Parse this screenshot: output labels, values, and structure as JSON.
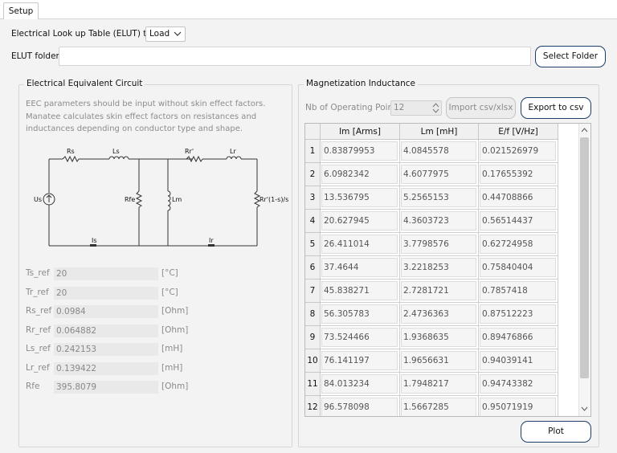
{
  "tabs": [
    {
      "label": "Setup"
    }
  ],
  "elut": {
    "type_label": "Electrical Look up Table (ELUT) type",
    "type_value": "Load",
    "folder_label": "ELUT folder",
    "folder_value": "",
    "select_folder_button": "Select Folder"
  },
  "eec": {
    "title": "Electrical Equivalent Circuit",
    "description": "EEC parameters should be input without skin effect factors. Manatee calculates skin effect factors on resistances and inductances depending on conductor type and shape.",
    "circuit_labels": {
      "rs": "Rs",
      "ls": "Ls",
      "rr": "Rr'",
      "lr": "Lr",
      "us": "Us",
      "rfe": "Rfe",
      "lm": "Lm",
      "rload": "Rr'(1-s)/s",
      "is": "Is",
      "ir": "Ir"
    },
    "params": [
      {
        "label": "Ts_ref",
        "value": "20",
        "unit": "[°C]"
      },
      {
        "label": "Tr_ref",
        "value": "20",
        "unit": "[°C]"
      },
      {
        "label": "Rs_ref",
        "value": "0.0984",
        "unit": "[Ohm]"
      },
      {
        "label": "Rr_ref",
        "value": "0.064882",
        "unit": "[Ohm]"
      },
      {
        "label": "Ls_ref",
        "value": "0.242153",
        "unit": "[mH]"
      },
      {
        "label": "Lr_ref",
        "value": "0.139422",
        "unit": "[mH]"
      },
      {
        "label": "Rfe",
        "value": "395.8079",
        "unit": "[Ohm]"
      }
    ]
  },
  "mag": {
    "title": "Magnetization Inductance",
    "nb_points_label": "Nb of Operating Points",
    "nb_points_value": "12",
    "import_button": "Import csv/xlsx",
    "export_button": "Export to csv",
    "plot_button": "Plot",
    "columns": [
      "Im [Arms]",
      "Lm [mH]",
      "E/f [V/Hz]"
    ],
    "rows": [
      {
        "n": "1",
        "im": "0.83879953",
        "lm": "4.0845578",
        "ef": "0.021526979"
      },
      {
        "n": "2",
        "im": "6.0982342",
        "lm": "4.6077975",
        "ef": "0.17655392"
      },
      {
        "n": "3",
        "im": "13.536795",
        "lm": "5.2565153",
        "ef": "0.44708866"
      },
      {
        "n": "4",
        "im": "20.627945",
        "lm": "4.3603723",
        "ef": "0.56514437"
      },
      {
        "n": "5",
        "im": "26.411014",
        "lm": "3.7798576",
        "ef": "0.62724958"
      },
      {
        "n": "6",
        "im": "37.4644",
        "lm": "3.2218253",
        "ef": "0.75840404"
      },
      {
        "n": "7",
        "im": "45.838271",
        "lm": "2.7281721",
        "ef": "0.7857418"
      },
      {
        "n": "8",
        "im": "56.305783",
        "lm": "2.4736363",
        "ef": "0.87512223"
      },
      {
        "n": "9",
        "im": "73.524466",
        "lm": "1.9368635",
        "ef": "0.89476866"
      },
      {
        "n": "10",
        "im": "76.141197",
        "lm": "1.9656631",
        "ef": "0.94039141"
      },
      {
        "n": "11",
        "im": "84.013234",
        "lm": "1.7948217",
        "ef": "0.94743382"
      },
      {
        "n": "12",
        "im": "96.578098",
        "lm": "1.5667285",
        "ef": "0.95071919"
      }
    ]
  },
  "colors": {
    "button_border": "#1a3d66",
    "panel_bg": "#f3f3f3"
  }
}
